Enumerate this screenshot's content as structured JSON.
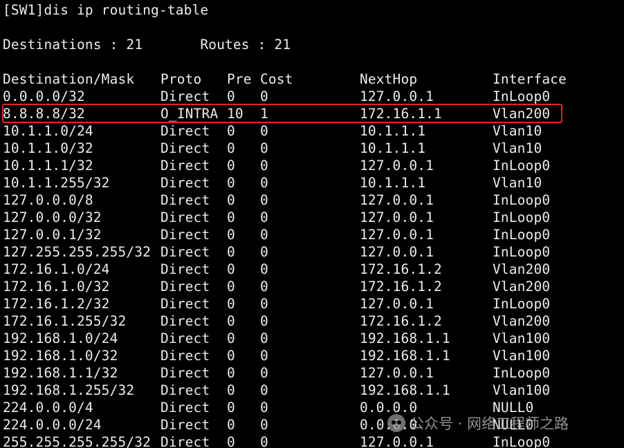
{
  "terminal": {
    "command": "[SW1]dis ip routing-table",
    "summary": "Destinations : 21       Routes : 21",
    "headers": {
      "destination": "Destination/Mask",
      "proto": "Proto",
      "pre": "Pre",
      "cost": "Cost",
      "nexthop": "NextHop",
      "interface": "Interface"
    },
    "rows": [
      {
        "dest": "0.0.0.0/32",
        "proto": "Direct",
        "pre": "0",
        "cost": "0",
        "nexthop": "127.0.0.1",
        "iface": "InLoop0"
      },
      {
        "dest": "8.8.8.8/32",
        "proto": "O_INTRA",
        "pre": "10",
        "cost": "1",
        "nexthop": "172.16.1.1",
        "iface": "Vlan200"
      },
      {
        "dest": "10.1.1.0/24",
        "proto": "Direct",
        "pre": "0",
        "cost": "0",
        "nexthop": "10.1.1.1",
        "iface": "Vlan10"
      },
      {
        "dest": "10.1.1.0/32",
        "proto": "Direct",
        "pre": "0",
        "cost": "0",
        "nexthop": "10.1.1.1",
        "iface": "Vlan10"
      },
      {
        "dest": "10.1.1.1/32",
        "proto": "Direct",
        "pre": "0",
        "cost": "0",
        "nexthop": "127.0.0.1",
        "iface": "InLoop0"
      },
      {
        "dest": "10.1.1.255/32",
        "proto": "Direct",
        "pre": "0",
        "cost": "0",
        "nexthop": "10.1.1.1",
        "iface": "Vlan10"
      },
      {
        "dest": "127.0.0.0/8",
        "proto": "Direct",
        "pre": "0",
        "cost": "0",
        "nexthop": "127.0.0.1",
        "iface": "InLoop0"
      },
      {
        "dest": "127.0.0.0/32",
        "proto": "Direct",
        "pre": "0",
        "cost": "0",
        "nexthop": "127.0.0.1",
        "iface": "InLoop0"
      },
      {
        "dest": "127.0.0.1/32",
        "proto": "Direct",
        "pre": "0",
        "cost": "0",
        "nexthop": "127.0.0.1",
        "iface": "InLoop0"
      },
      {
        "dest": "127.255.255.255/32",
        "proto": "Direct",
        "pre": "0",
        "cost": "0",
        "nexthop": "127.0.0.1",
        "iface": "InLoop0"
      },
      {
        "dest": "172.16.1.0/24",
        "proto": "Direct",
        "pre": "0",
        "cost": "0",
        "nexthop": "172.16.1.2",
        "iface": "Vlan200"
      },
      {
        "dest": "172.16.1.0/32",
        "proto": "Direct",
        "pre": "0",
        "cost": "0",
        "nexthop": "172.16.1.2",
        "iface": "Vlan200"
      },
      {
        "dest": "172.16.1.2/32",
        "proto": "Direct",
        "pre": "0",
        "cost": "0",
        "nexthop": "127.0.0.1",
        "iface": "InLoop0"
      },
      {
        "dest": "172.16.1.255/32",
        "proto": "Direct",
        "pre": "0",
        "cost": "0",
        "nexthop": "172.16.1.2",
        "iface": "Vlan200"
      },
      {
        "dest": "192.168.1.0/24",
        "proto": "Direct",
        "pre": "0",
        "cost": "0",
        "nexthop": "192.168.1.1",
        "iface": "Vlan100"
      },
      {
        "dest": "192.168.1.0/32",
        "proto": "Direct",
        "pre": "0",
        "cost": "0",
        "nexthop": "192.168.1.1",
        "iface": "Vlan100"
      },
      {
        "dest": "192.168.1.1/32",
        "proto": "Direct",
        "pre": "0",
        "cost": "0",
        "nexthop": "127.0.0.1",
        "iface": "InLoop0"
      },
      {
        "dest": "192.168.1.255/32",
        "proto": "Direct",
        "pre": "0",
        "cost": "0",
        "nexthop": "192.168.1.1",
        "iface": "Vlan100"
      },
      {
        "dest": "224.0.0.0/4",
        "proto": "Direct",
        "pre": "0",
        "cost": "0",
        "nexthop": "0.0.0.0",
        "iface": "NULL0"
      },
      {
        "dest": "224.0.0.0/24",
        "proto": "Direct",
        "pre": "0",
        "cost": "0",
        "nexthop": "0.0.0.0",
        "iface": "NULL0"
      },
      {
        "dest": "255.255.255.255/32",
        "proto": "Direct",
        "pre": "0",
        "cost": "0",
        "nexthop": "127.0.0.1",
        "iface": "InLoop0"
      }
    ],
    "highlight_row_index": 1,
    "highlight_color": "#e0261f",
    "text_color": "#ececec",
    "background_color": "#000000"
  },
  "watermark": {
    "icon": "wechat-icon",
    "text": "公众号 · 网络工程师之路"
  }
}
